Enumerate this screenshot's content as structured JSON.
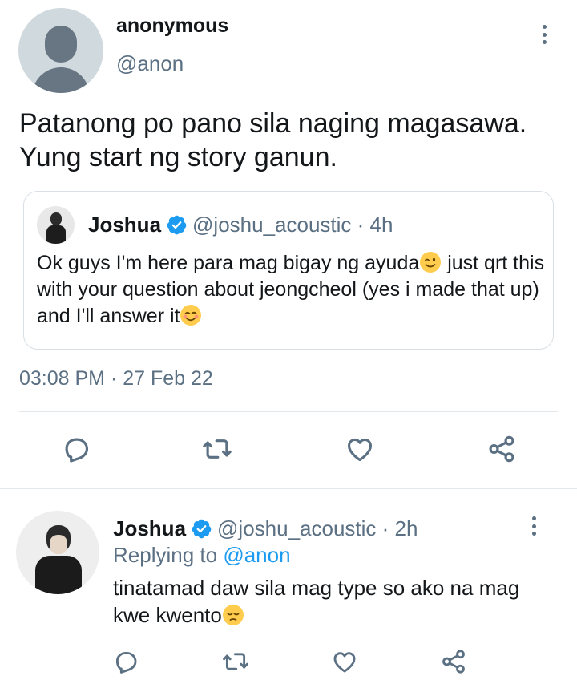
{
  "tweet": {
    "author_name": "anonymous",
    "author_handle": "@anon",
    "text": "Patanong po pano sila naging magasawa. Yung start ng story ganun.",
    "timestamp": "03:08 PM · 27 Feb 22"
  },
  "quote": {
    "author_name": "Joshua",
    "author_handle": "@joshu_acoustic · 4h",
    "text_part1": "Ok guys I'm here para mag bigay ng ayuda",
    "emoji1": "winking-face",
    "text_part2": " just qrt this with your question about jeongcheol (yes i made that up) and I'll answer it",
    "emoji2": "smiling-face"
  },
  "actions": [
    "reply-icon",
    "retweet-icon",
    "like-icon",
    "share-icon"
  ],
  "reply": {
    "author_name": "Joshua",
    "author_handle": "@joshu_acoustic · 2h",
    "replying_label": "Replying to",
    "replying_mention": "@anon",
    "text": "tinatamad daw sila mag type so ako na mag kwe kwento",
    "emoji": "pensive-face"
  },
  "colors": {
    "accent": "#1d9bf0",
    "secondary_text": "#5b7083",
    "primary_text": "#14171a",
    "divider": "#e3e8ec"
  }
}
